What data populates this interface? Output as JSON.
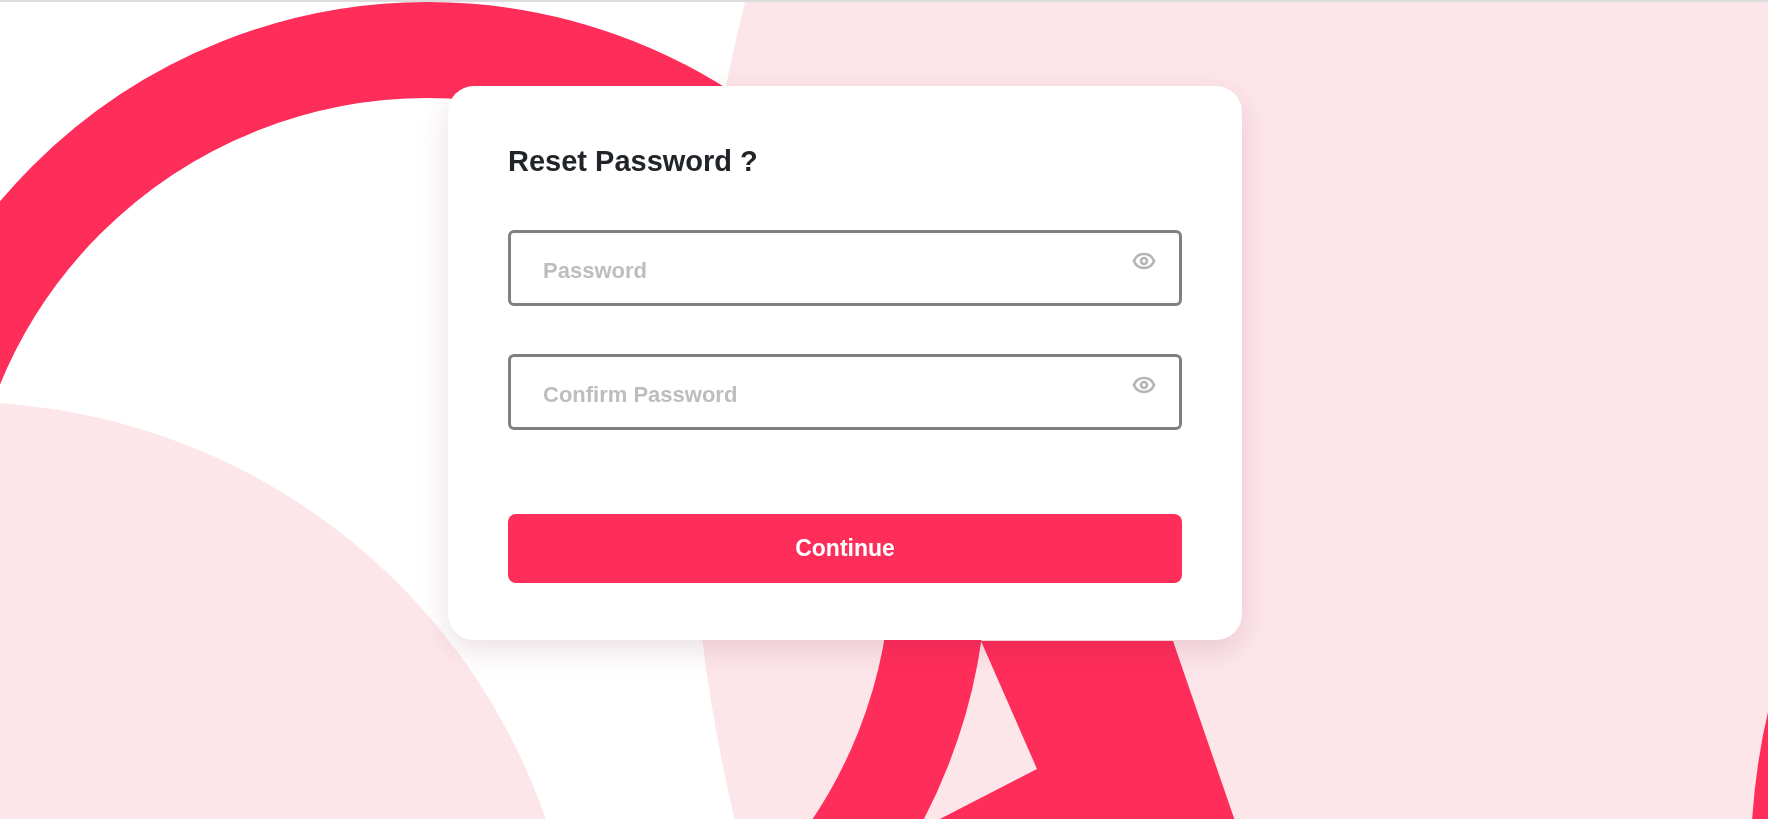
{
  "card": {
    "title": "Reset Password ?",
    "fields": [
      {
        "placeholder": "Password"
      },
      {
        "placeholder": "Confirm Password"
      }
    ],
    "button": "Continue"
  }
}
